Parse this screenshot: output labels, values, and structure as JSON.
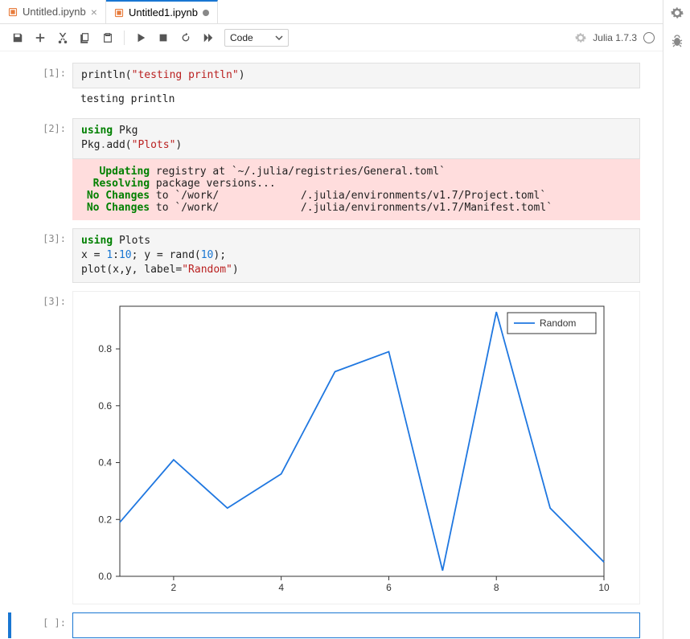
{
  "tabs": [
    {
      "icon": "notebook",
      "label": "Untitled.ipynb",
      "dirty": false,
      "active": false
    },
    {
      "icon": "notebook",
      "label": "Untitled1.ipynb",
      "dirty": true,
      "active": true
    }
  ],
  "toolbar": {
    "cell_type": "Code",
    "kernel_label": "Julia 1.7.3"
  },
  "cells": [
    {
      "prompt": "[1]:",
      "code_html": "println(<span class='s-s'>\"testing println\"</span>)",
      "output_text": "testing println"
    },
    {
      "prompt": "[2]:",
      "code_html": "<span class='s-k'>using</span> Pkg\nPkg<span class='s-p'>.</span>add(<span class='s-s'>\"Plots\"</span>)",
      "stderr_html": "   <span class='s-b'>Updating</span> registry at `~/.julia/registries/General.toml`\n  <span class='s-b'>Resolving</span> package versions...\n <span class='s-b'>No Changes</span> to `/work/             /.julia/environments/v1.7/Project.toml`\n <span class='s-b'>No Changes</span> to `/work/             /.julia/environments/v1.7/Manifest.toml`"
    },
    {
      "prompt": "[3]:",
      "code_html": "<span class='s-k'>using</span> Plots\nx = <span class='s-n'>1</span>:<span class='s-n'>10</span>; y = rand(<span class='s-n'>10</span>);\nplot(x,y, label=<span class='s-s'>\"Random\"</span>)",
      "output_prompt": "[3]:"
    }
  ],
  "empty_prompt": "[ ]:",
  "chart_data": {
    "type": "line",
    "title": "",
    "xlabel": "",
    "ylabel": "",
    "x": [
      1,
      2,
      3,
      4,
      5,
      6,
      7,
      8,
      9,
      10
    ],
    "series": [
      {
        "name": "Random",
        "values": [
          0.19,
          0.41,
          0.24,
          0.36,
          0.72,
          0.79,
          0.02,
          0.93,
          0.24,
          0.05
        ]
      }
    ],
    "x_ticks": [
      2,
      4,
      6,
      8,
      10
    ],
    "y_ticks": [
      0.0,
      0.2,
      0.4,
      0.6,
      0.8
    ],
    "ylim": [
      0.0,
      0.95
    ],
    "xlim": [
      1,
      10
    ],
    "legend_position": "top-right",
    "line_color": "#1f77e0"
  }
}
